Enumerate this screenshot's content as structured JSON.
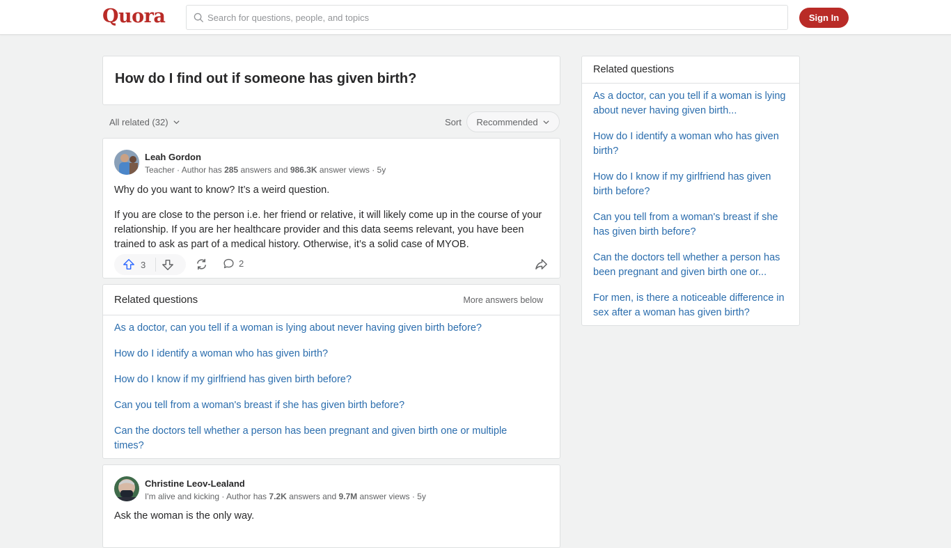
{
  "header": {
    "logo": "Quora",
    "search_placeholder": "Search for questions, people, and topics",
    "signin_label": "Sign In",
    "brand_color": "#b92b27"
  },
  "question": {
    "title": "How do I find out if someone has given birth?"
  },
  "filters": {
    "all_related": "All related (32)",
    "sort_label": "Sort",
    "sort_value": "Recommended"
  },
  "answers": [
    {
      "author": "Leah Gordon",
      "credential": "Teacher",
      "meta_prefix": " · Author has ",
      "answers_count": "285",
      "meta_mid": " answers and ",
      "views": "986.3K",
      "meta_suffix": " answer views · 5y",
      "paragraphs": [
        "Why do you want to know? It’s a weird question.",
        "If you are close to the person i.e. her friend or relative, it will likely come up in the course of your relationship. If you are her healthcare provider and this data seems relevant, you have been trained to ask as part of a medical history. Otherwise, it’s a solid case of MYOB."
      ],
      "upvotes": "3",
      "comments": "2"
    },
    {
      "author": "Christine Leov-Lealand",
      "credential": "I'm alive and kicking",
      "meta_prefix": " · Author has ",
      "answers_count": "7.2K",
      "meta_mid": " answers and ",
      "views": "9.7M",
      "meta_suffix": " answer views · 5y",
      "paragraphs": [
        "Ask the woman is the only way."
      ]
    }
  ],
  "related_inline": {
    "title": "Related questions",
    "more": "More answers below",
    "items": [
      "As a doctor, can you tell if a woman is lying about never having given birth before?",
      "How do I identify a woman who has given birth?",
      "How do I know if my girlfriend has given birth before?",
      "Can you tell from a woman's breast if she has given birth before?",
      "Can the doctors tell whether a person has been pregnant and given birth one or multiple times?"
    ]
  },
  "sidebar": {
    "title": "Related questions",
    "items": [
      "As a doctor, can you tell if a woman is lying about never having given birth...",
      "How do I identify a woman who has given birth?",
      "How do I know if my girlfriend has given birth before?",
      "Can you tell from a woman's breast if she has given birth before?",
      "Can the doctors tell whether a person has been pregnant and given birth one or...",
      "For men, is there a noticeable difference in sex after a woman has given birth?"
    ]
  }
}
